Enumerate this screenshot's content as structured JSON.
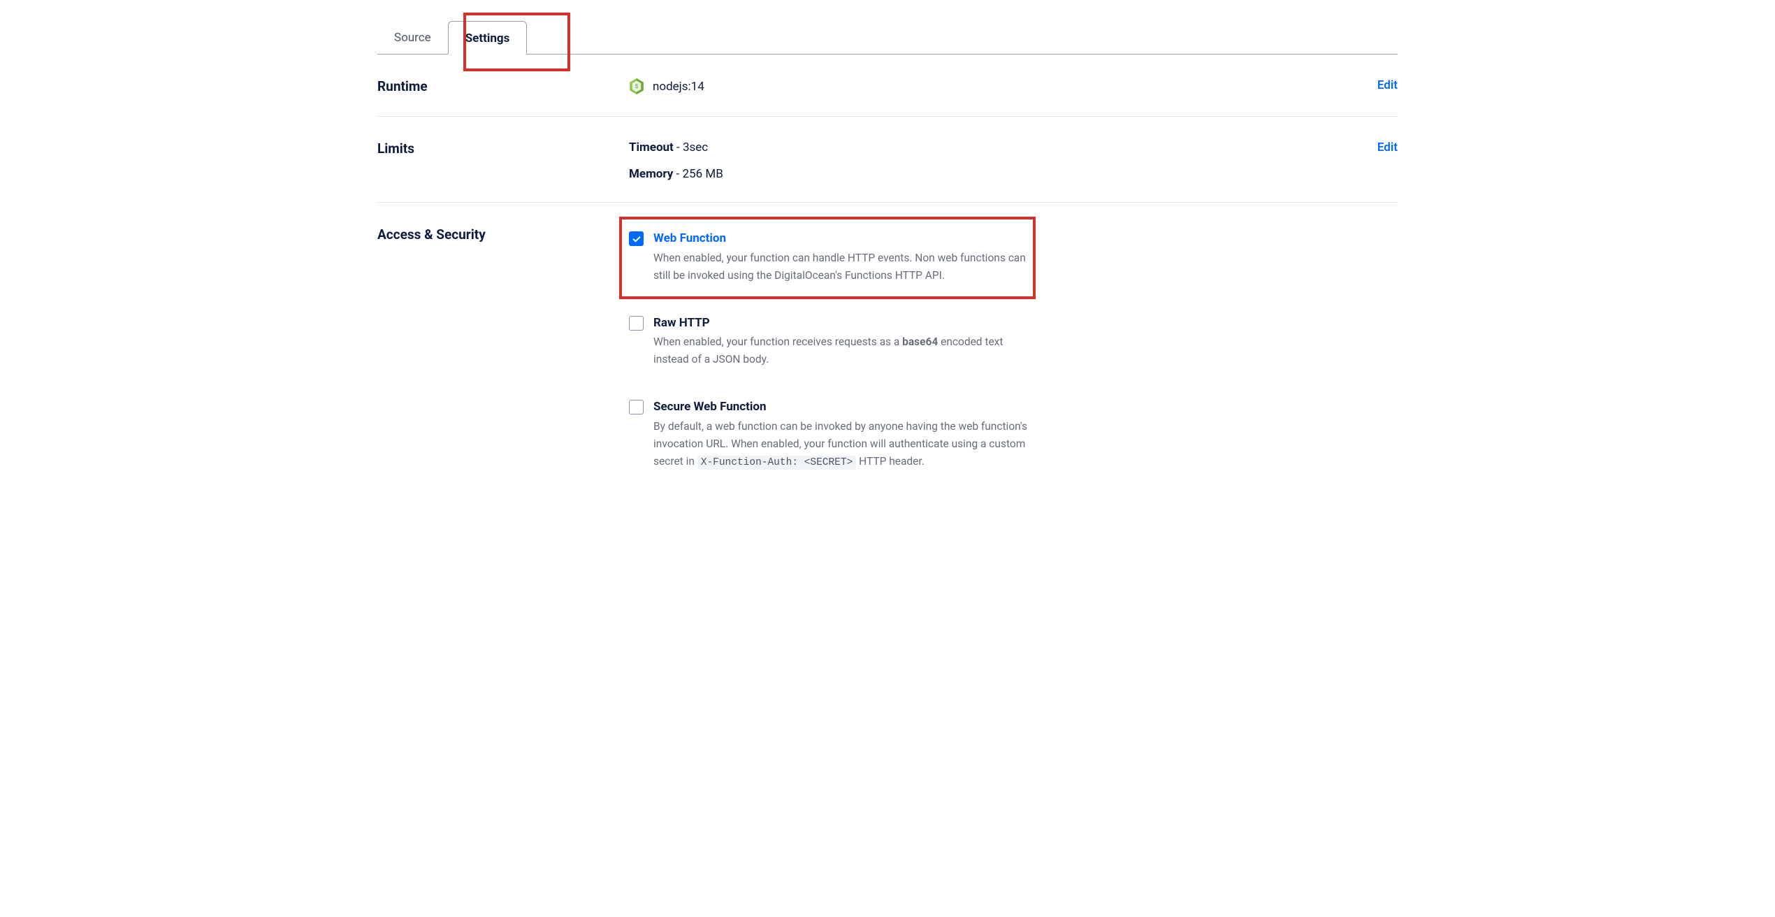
{
  "tabs": {
    "source": "Source",
    "settings": "Settings"
  },
  "sections": {
    "runtime": {
      "label": "Runtime",
      "value": "nodejs:14",
      "edit": "Edit"
    },
    "limits": {
      "label": "Limits",
      "timeout_label": "Timeout",
      "timeout_value": "3sec",
      "memory_label": "Memory",
      "memory_value": "256 MB",
      "edit": "Edit"
    },
    "access": {
      "label": "Access & Security",
      "items": [
        {
          "title": "Web Function",
          "checked": true,
          "desc": "When enabled, your function can handle HTTP events. Non web functions can still be invoked using the DigitalOcean's Functions HTTP API."
        },
        {
          "title": "Raw HTTP",
          "checked": false,
          "desc_pre": "When enabled, your function receives requests as a ",
          "desc_bold": "base64",
          "desc_post": " encoded text instead of a JSON body."
        },
        {
          "title": "Secure Web Function",
          "checked": false,
          "desc_pre": "By default, a web function can be invoked by anyone having the web function's invocation URL. When enabled, your function will authenticate using a custom secret in ",
          "desc_code": "X-Function-Auth: <SECRET>",
          "desc_post": " HTTP header."
        }
      ]
    }
  }
}
